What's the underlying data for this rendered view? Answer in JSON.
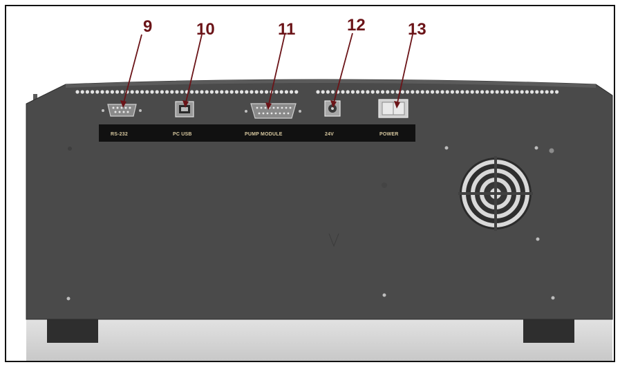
{
  "colors": {
    "panel": "#4a4a4a",
    "panel_dark": "#333333",
    "label_strip": "#111111",
    "label_text": "#d8c9a0",
    "callout": "#6b1418",
    "base": "#d6d6d6",
    "frame": "#111111"
  },
  "callouts": [
    {
      "number": "9",
      "port": "rs232"
    },
    {
      "number": "10",
      "port": "pc-usb"
    },
    {
      "number": "11",
      "port": "pump-module"
    },
    {
      "number": "12",
      "port": "24v"
    },
    {
      "number": "13",
      "port": "power"
    }
  ],
  "port_labels": {
    "rs232": "RS-232",
    "pc_usb": "PC USB",
    "pump_module": "PUMP MODULE",
    "v24": "24V",
    "power": "POWER"
  },
  "icons": [
    "fan-grille-icon",
    "screw-icon"
  ]
}
